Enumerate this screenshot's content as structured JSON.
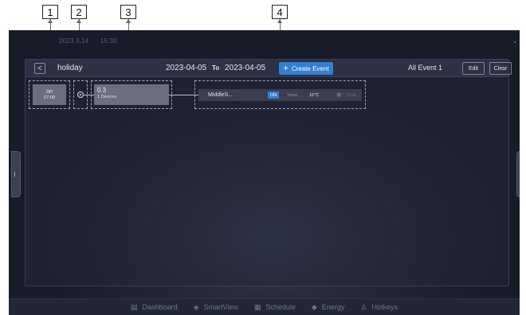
{
  "callouts": [
    "1",
    "2",
    "3",
    "4"
  ],
  "status": {
    "date": "2023.3.14",
    "time": "15:30"
  },
  "toolbar": {
    "back_icon": "chevron-left-icon",
    "back_glyph": "<",
    "title": "holiday",
    "start_date": "2023-04-05",
    "to_label": "To",
    "end_date": "2023-04-05",
    "create_label": "Create Event",
    "create_icon": "plus-icon",
    "all_event_label": "All Event 1",
    "edit_label": "Edit",
    "clear_label": "Clear"
  },
  "event": {
    "state": "on",
    "time": "07:00",
    "group_name": "0.3",
    "group_devices": "1 Devices",
    "device": {
      "name": "MiddleS...",
      "power": "ON",
      "temp_label": "Temp",
      "temp_value": "16℃",
      "mode_icon": "snowflake-icon",
      "mode": "Cool"
    }
  },
  "nav": [
    {
      "label": "Dashboard",
      "icon": "dashboard-icon"
    },
    {
      "label": "SmartView",
      "icon": "smartview-icon"
    },
    {
      "label": "Schedule",
      "icon": "schedule-icon"
    },
    {
      "label": "Energy",
      "icon": "energy-icon"
    },
    {
      "label": "Hotkeys",
      "icon": "hotkeys-icon"
    }
  ],
  "colors": {
    "accent": "#2f7fd6",
    "background": "#1c2030",
    "card": "#6b6f7f"
  }
}
